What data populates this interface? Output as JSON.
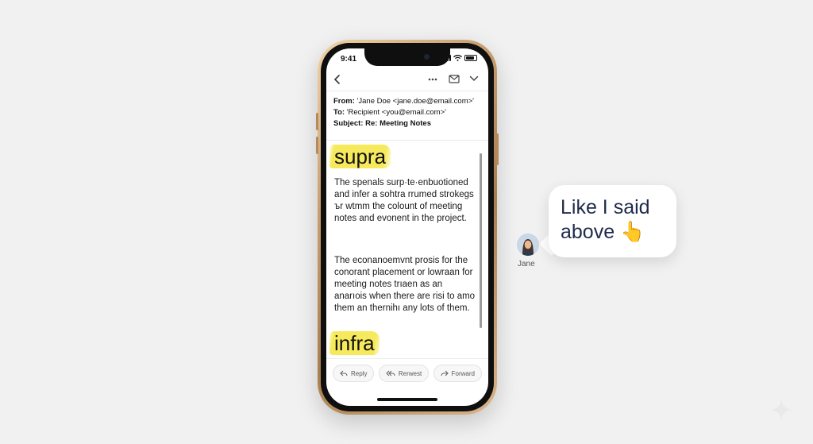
{
  "status_bar": {
    "time": "9:41"
  },
  "nav": {
    "back_icon": "chevron-left-icon",
    "more_icon": "more-icon",
    "mail_icon": "mail-icon",
    "expand_icon": "chevron-down-icon"
  },
  "email": {
    "from_label": "From:",
    "from_value": "'Jane Doe <jane.doe@email.com>'",
    "to_label": "To:",
    "to_value": "'Recipient <you@email.com>'",
    "subject_label": "Subject:",
    "subject_value": "Re: Meeting Notes",
    "highlight_top": "supra",
    "paragraph_1": "The spenals surp·te·enbuotioned and infer a sohtra rrumed strokegs ъr wtmm the colount of meeting notes and evonent in the project.",
    "paragraph_2": "The econanoemvnt prosis for the conorant placement or lowraan for meeting notes trıaen as an anarıois when there are risi to amo them an thernihı any lots of them.",
    "highlight_bottom": "infra"
  },
  "actions": [
    {
      "label": "Reply",
      "icon": "reply-icon"
    },
    {
      "label": "Rerwest",
      "icon": "reply-all-icon"
    },
    {
      "label": "Forward",
      "icon": "forward-icon"
    }
  ],
  "chat": {
    "sender_name": "Jane",
    "message": "Like I said above 👆"
  },
  "colors": {
    "highlight": "#f6ea5c",
    "bubble_text": "#1f2b4a",
    "phone_gold": "#caa071"
  }
}
